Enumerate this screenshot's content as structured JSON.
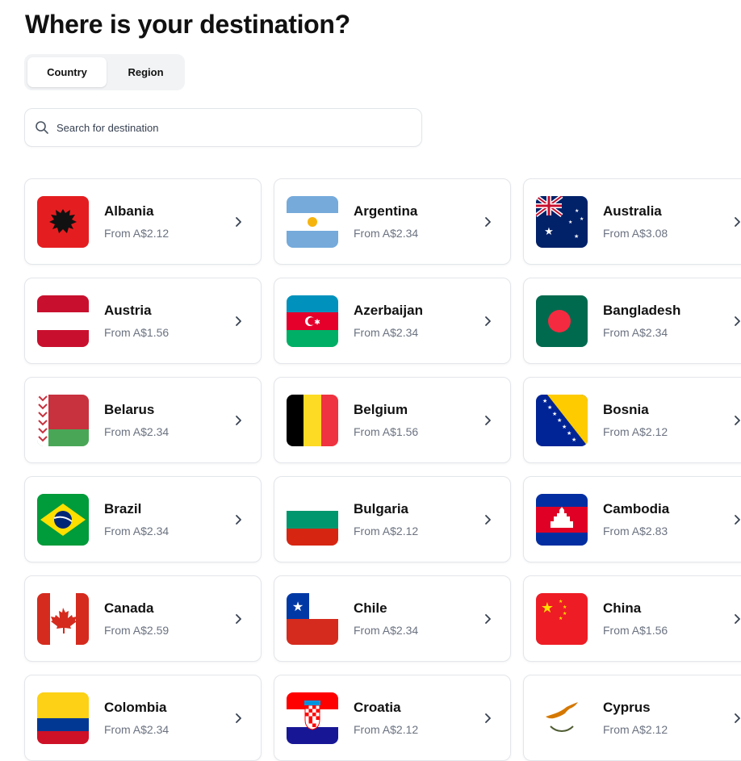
{
  "page": {
    "title": "Where is your destination?"
  },
  "tabs": [
    {
      "label": "Country",
      "active": true
    },
    {
      "label": "Region",
      "active": false
    }
  ],
  "search": {
    "placeholder": "Search for destination",
    "value": ""
  },
  "countries": [
    {
      "name": "Albania",
      "price": "From A$2.12",
      "flag_icon": "albania-flag-icon"
    },
    {
      "name": "Argentina",
      "price": "From A$2.34",
      "flag_icon": "argentina-flag-icon"
    },
    {
      "name": "Australia",
      "price": "From A$3.08",
      "flag_icon": "australia-flag-icon"
    },
    {
      "name": "Austria",
      "price": "From A$1.56",
      "flag_icon": "austria-flag-icon"
    },
    {
      "name": "Azerbaijan",
      "price": "From A$2.34",
      "flag_icon": "azerbaijan-flag-icon"
    },
    {
      "name": "Bangladesh",
      "price": "From A$2.34",
      "flag_icon": "bangladesh-flag-icon"
    },
    {
      "name": "Belarus",
      "price": "From A$2.34",
      "flag_icon": "belarus-flag-icon"
    },
    {
      "name": "Belgium",
      "price": "From A$1.56",
      "flag_icon": "belgium-flag-icon"
    },
    {
      "name": "Bosnia",
      "price": "From A$2.12",
      "flag_icon": "bosnia-flag-icon"
    },
    {
      "name": "Brazil",
      "price": "From A$2.34",
      "flag_icon": "brazil-flag-icon"
    },
    {
      "name": "Bulgaria",
      "price": "From A$2.12",
      "flag_icon": "bulgaria-flag-icon"
    },
    {
      "name": "Cambodia",
      "price": "From A$2.83",
      "flag_icon": "cambodia-flag-icon"
    },
    {
      "name": "Canada",
      "price": "From A$2.59",
      "flag_icon": "canada-flag-icon"
    },
    {
      "name": "Chile",
      "price": "From A$2.34",
      "flag_icon": "chile-flag-icon"
    },
    {
      "name": "China",
      "price": "From A$1.56",
      "flag_icon": "china-flag-icon"
    },
    {
      "name": "Colombia",
      "price": "From A$2.34",
      "flag_icon": "colombia-flag-icon"
    },
    {
      "name": "Croatia",
      "price": "From A$2.12",
      "flag_icon": "croatia-flag-icon"
    },
    {
      "name": "Cyprus",
      "price": "From A$2.12",
      "flag_icon": "cyprus-flag-icon"
    }
  ]
}
